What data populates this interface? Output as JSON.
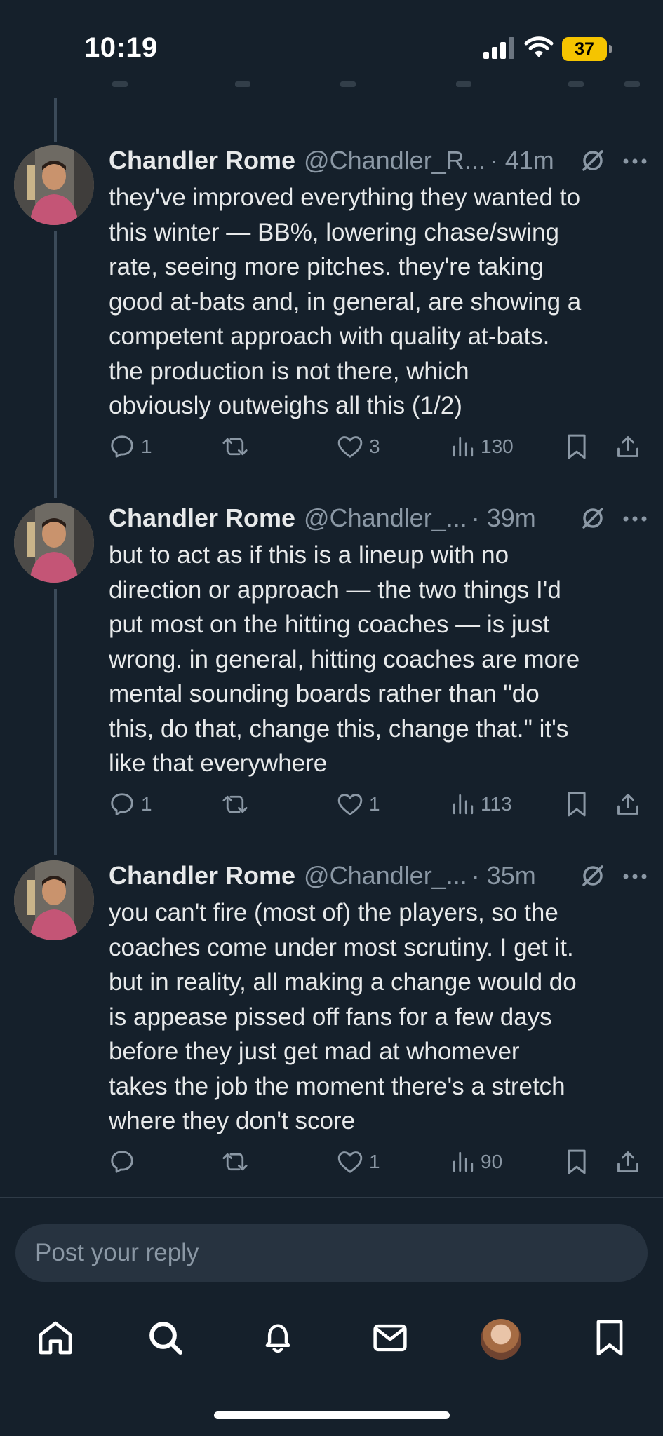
{
  "status_bar": {
    "time": "10:19",
    "battery": "37",
    "icons": [
      "cellular-signal-icon",
      "wifi-icon",
      "battery-icon"
    ]
  },
  "tweets": [
    {
      "name": "Chandler Rome",
      "handle": "@Chandler_R...",
      "time": "· 41m",
      "text": "they've improved everything they wanted to\nthis winter — BB%, lowering chase/swing\nrate, seeing more pitches. they're taking\ngood at-bats and, in general, are showing a\ncompetent approach with quality at-bats.\nthe production is not there, which\nobviously outweighs all this (1/2)",
      "replies": "1",
      "reposts": "",
      "likes": "3",
      "views": "130"
    },
    {
      "name": "Chandler Rome",
      "handle": "@Chandler_...",
      "time": "· 39m",
      "text": "but to act as if this is a lineup with no\ndirection or approach — the two things I'd\nput most on the hitting coaches — is just\nwrong. in general, hitting coaches are more\nmental sounding boards rather than \"do\nthis, do that, change this, change that.\" it's\nlike that everywhere",
      "replies": "1",
      "reposts": "",
      "likes": "1",
      "views": "113"
    },
    {
      "name": "Chandler Rome",
      "handle": "@Chandler_...",
      "time": "· 35m",
      "text": "you can't fire (most of) the players, so the\ncoaches come under most scrutiny. I get it.\nbut in reality, all making a change would do\nis appease pissed off fans for a few days\nbefore they just get mad at whomever\ntakes the job the moment there's a stretch\nwhere they don't score",
      "replies": "",
      "reposts": "",
      "likes": "1",
      "views": "90"
    }
  ],
  "reply": {
    "placeholder": "Post your reply"
  },
  "bottom_nav": [
    "home-icon",
    "search-icon",
    "notifications-icon",
    "messages-icon",
    "profile-avatar",
    "bookmarks-icon"
  ],
  "colors": {
    "background": "#15202b",
    "text": "#e7e9ea",
    "muted": "#8b98a5",
    "battery": "#f5c400"
  }
}
